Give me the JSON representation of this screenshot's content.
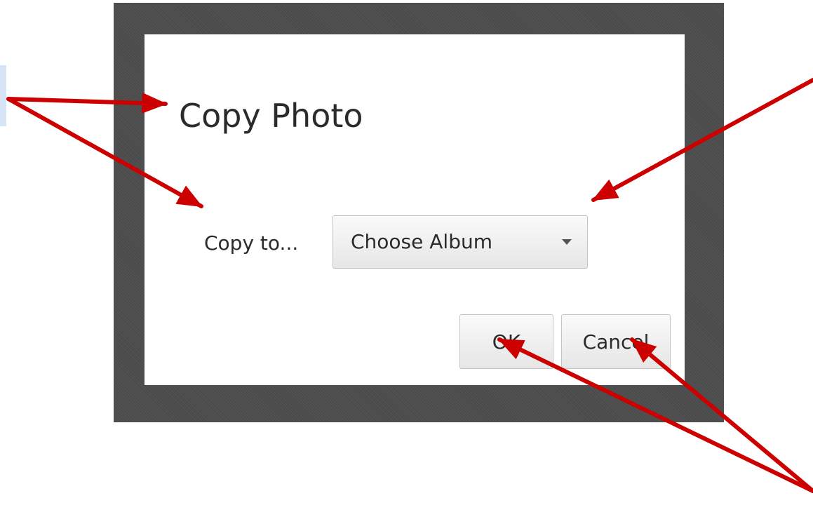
{
  "dialog": {
    "title": "Copy Photo",
    "copy_label": "Copy to...",
    "album_dropdown": {
      "selected": "Choose Album"
    },
    "buttons": {
      "ok_label": "OK",
      "cancel_label": "Cancel"
    }
  },
  "colors": {
    "frame": "#4b4b4b",
    "dialog_background": "#ffffff",
    "annotation_arrow": "#cc0000",
    "left_highlight": "#d5e5f5"
  },
  "icons": {
    "dropdown": "chevron-down-icon"
  }
}
